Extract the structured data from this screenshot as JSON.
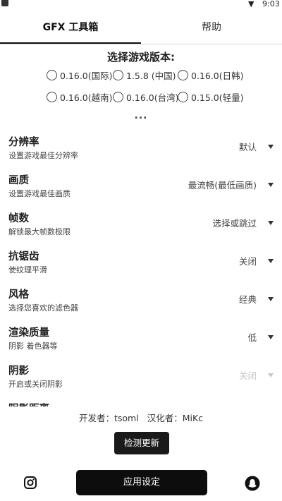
{
  "status_bar": {
    "time": "9:03"
  },
  "tabs": [
    {
      "label": "GFX 工具箱",
      "active": true
    },
    {
      "label": "帮助",
      "active": false
    }
  ],
  "version_section": {
    "title": "选择游戏版本:",
    "options": [
      {
        "label": "0.16.0(国际)"
      },
      {
        "label": "1.5.8 (中国)"
      },
      {
        "label": "0.16.0(日韩)"
      },
      {
        "label": "0.16.0(越南)"
      },
      {
        "label": "0.16.0(台湾)"
      },
      {
        "label": "0.15.0(轻量)"
      }
    ],
    "more": "..."
  },
  "settings": [
    {
      "title": "分辨率",
      "subtitle": "设置游戏最佳分辨率",
      "value": "默认"
    },
    {
      "title": "画质",
      "subtitle": "设置游戏最佳画质",
      "value": "最流畅(最低画质)"
    },
    {
      "title": "帧数",
      "subtitle": "解锁最大帧数极限",
      "value": "选择或跳过"
    },
    {
      "title": "抗锯齿",
      "subtitle": "使纹理平滑",
      "value": "关闭"
    },
    {
      "title": "风格",
      "subtitle": "选择您喜欢的滤色器",
      "value": "经典"
    },
    {
      "title": "渲染质量",
      "subtitle": "阴影 着色器等",
      "value": "低"
    },
    {
      "title": "阴影",
      "subtitle": "开启或关闭阴影",
      "value": "关闭",
      "disabled": true
    }
  ],
  "partial_setting": {
    "title": "阴影距离"
  },
  "footer": {
    "developer": "开发者：tsoml",
    "translator": "汉化者：MiKc",
    "check_update": "检测更新",
    "apply": "应用设定"
  },
  "icons": {
    "left": "instagram-icon",
    "right": "snapchat-icon",
    "status": [
      "sim-icon",
      "wifi-icon"
    ]
  }
}
